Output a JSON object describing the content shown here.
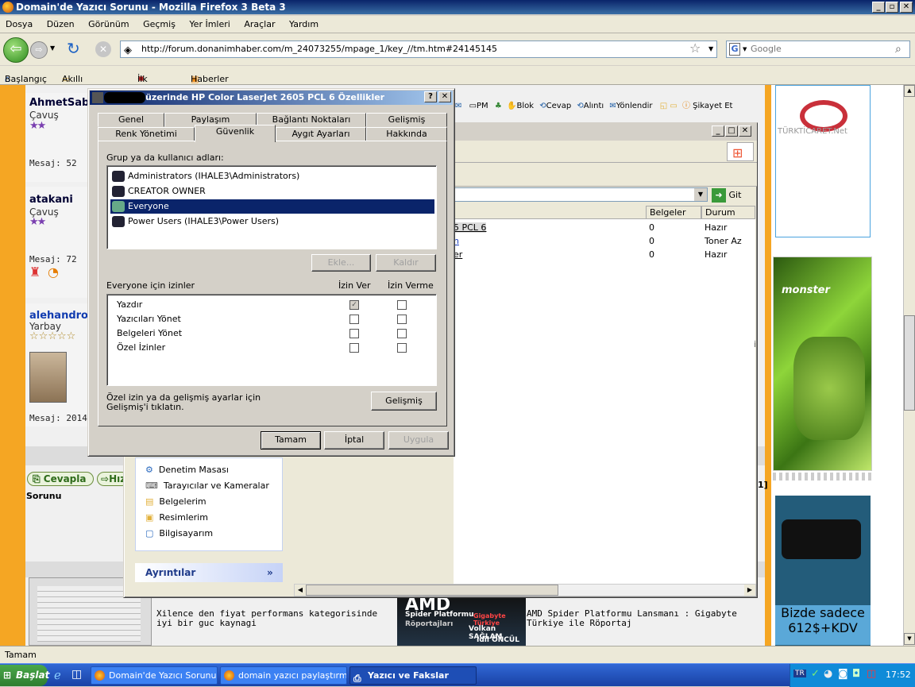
{
  "window": {
    "title": "Domain'de Yazıcı Sorunu - Mozilla Firefox 3 Beta 3"
  },
  "menu": [
    "Dosya",
    "Düzen",
    "Görünüm",
    "Geçmiş",
    "Yer İmleri",
    "Araçlar",
    "Yardım"
  ],
  "nav": {
    "url": "http://forum.donanimhaber.com/m_24073255/mpage_1/key_//tm.htm#24145145",
    "search_placeholder": "Google"
  },
  "bookmarks": [
    "Başlangıç",
    "Akıllı Yer İmleri",
    "İlk Adım",
    "Haberler"
  ],
  "forum": {
    "users": [
      {
        "name": "AhmetSab",
        "rank": "Çavuş",
        "stars": "★★",
        "msg": "Mesaj: 52"
      },
      {
        "name": "atakani",
        "rank": "Çavuş",
        "stars": "★★",
        "msg": "Mesaj: 72"
      },
      {
        "name": "alehandro",
        "rank": "Yarbay",
        "stars": "☆☆☆☆☆",
        "msg": "Mesaj: 2014"
      }
    ],
    "toolbar": [
      "PM",
      "Blok",
      "Cevap",
      "Alıntı",
      "Yönlendir",
      "Şikayet Et"
    ],
    "reply_button": "Cevapla",
    "quick_button": "Hız",
    "topic_label": "Sorunu",
    "ad1_text": "Xilence den fiyat performans kategorisinde iyi bir guc kaynagi",
    "ad2_text": "AMD Spider Platformu Lansmanı : Gigabyte Türkiye ile Röportaj",
    "ad2_img": {
      "l1": "Spider Platformu",
      "l2": "Röportajları",
      "l3": "Gigabyte Türkiye",
      "l4": "Volkan SAĞLAM",
      "l5": "İdil ÖNCÜL"
    },
    "side_ad1": "TÜRKTİCARET.Net",
    "side_ad3": {
      "l1": "Bizde sadece",
      "l2": "612$+KDV"
    },
    "monster": "monster"
  },
  "printers_window": {
    "go_label": "Git",
    "headers": [
      "Belgeler",
      "Durum"
    ],
    "rows": [
      {
        "name": "5 PCL 6",
        "docs": "0",
        "status": "Hazır"
      },
      {
        "name": "n",
        "docs": "0",
        "status": "Toner Az"
      },
      {
        "name": "er",
        "docs": "0",
        "status": "Hazır"
      }
    ],
    "tasks": [
      "Denetim Masası",
      "Tarayıcılar ve Kameralar",
      "Belgelerim",
      "Resimlerim",
      "Bilgisayarım"
    ],
    "details": "Ayrıntılar",
    "right_char": "i",
    "right_char2": "1]"
  },
  "dialog": {
    "title": "üzerinde HP Color LaserJet 2605 PCL 6 Özellikler",
    "tabs_top": [
      "Genel",
      "Paylaşım",
      "Bağlantı Noktaları",
      "Gelişmiş"
    ],
    "tabs_bottom": [
      "Renk Yönetimi",
      "Güvenlik",
      "Aygıt Ayarları",
      "Hakkında"
    ],
    "group_label": "Grup ya da kullanıcı adları:",
    "users": [
      "Administrators (IHALE3\\Administrators)",
      "CREATOR OWNER",
      "Everyone",
      "Power Users (IHALE3\\Power Users)"
    ],
    "add": "Ekle...",
    "remove": "Kaldır",
    "perm_label": "Everyone için izinler",
    "allow": "İzin Ver",
    "deny": "İzin Verme",
    "perms": [
      "Yazdır",
      "Yazıcıları Yönet",
      "Belgeleri Yönet",
      "Özel İzinler"
    ],
    "advanced_text": "Özel izin ya da gelişmiş ayarlar için Gelişmiş'i tıklatın.",
    "advanced": "Gelişmiş",
    "ok": "Tamam",
    "cancel": "İptal",
    "apply": "Uygula"
  },
  "status": "Tamam",
  "taskbar": {
    "start": "Başlat",
    "tasks": [
      "Domain'de Yazıcı Sorunu ...",
      "domain yazıcı paylaştırm...",
      "Yazıcı ve Fakslar"
    ],
    "lang": "TR",
    "clock": "17:52"
  }
}
